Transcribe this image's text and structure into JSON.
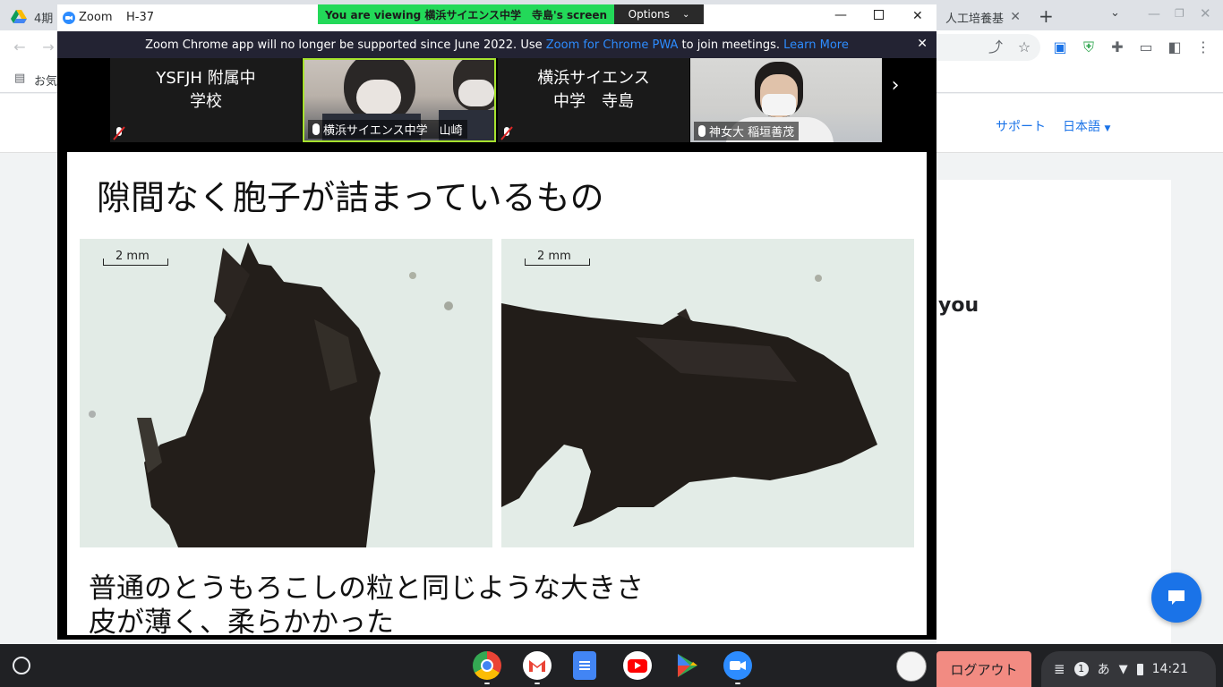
{
  "chrome": {
    "tabs": [
      {
        "label": "4期"
      },
      {
        "label": "人工培養基"
      }
    ],
    "bookmark_label": "お気",
    "header_links": [
      "サポート",
      "日本語"
    ],
    "page_partial_text": "you"
  },
  "zoom": {
    "app_name": "Zoom",
    "window_title": "H-37",
    "viewing_banner": "You are viewing 横浜サイエンス中学　寺島's screen",
    "options_label": "Options",
    "notice_text": "Zoom Chrome app will no longer be supported since June 2022. Use ",
    "notice_link1": "Zoom for Chrome PWA",
    "notice_mid": " to join meetings. ",
    "notice_link2": "Learn More",
    "participants": [
      {
        "name_line1": "YSFJH 附属中",
        "name_line2": "学校",
        "muted": true
      },
      {
        "label": "横浜サイエンス中学　山崎",
        "muted": false,
        "active": true
      },
      {
        "name_line1": "横浜サイエンス",
        "name_line2": "中学　寺島",
        "muted": true
      },
      {
        "label": "神女大 稲垣善茂",
        "muted": false
      }
    ]
  },
  "slide": {
    "title": "隙間なく胞子が詰まっているもの",
    "scale_left": "2 mm",
    "scale_right": "2 mm",
    "line1": "普通のとうもろこしの粒と同じような大きさ",
    "line2": "皮が薄く、柔らかかった"
  },
  "shelf": {
    "logout_label": "ログアウト",
    "notification_count": "1",
    "ime_label": "あ",
    "time": "14:21"
  },
  "colors": {
    "zoom_blue": "#2d8cff",
    "viewing_green": "#23d959",
    "logout_red": "#f28b82"
  }
}
